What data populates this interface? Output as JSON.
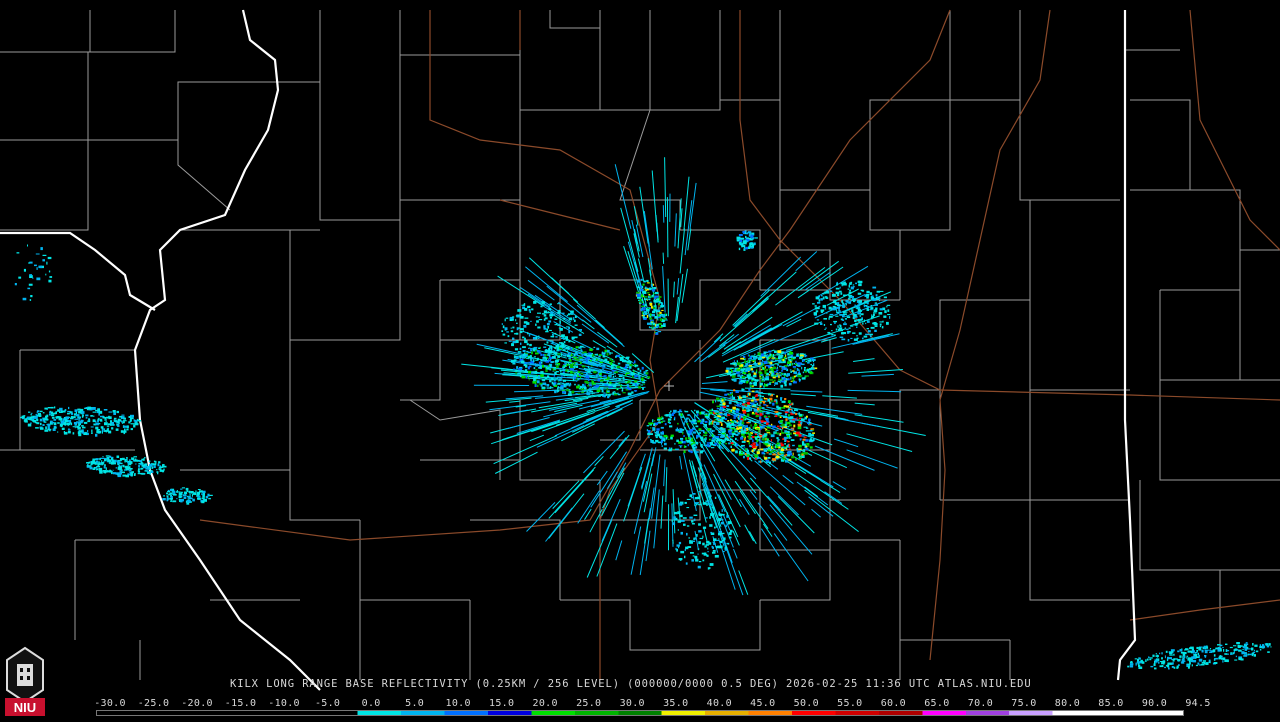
{
  "caption": "KILX LONG RANGE BASE REFLECTIVITY (0.25KM / 256 LEVEL) (000000/0000 0.5 DEG) 2026-02-25 11:36 UTC  ATLAS.NIU.EDU",
  "logo": {
    "text": "NIU",
    "color": "#c8102e"
  },
  "map_colors": {
    "background": "#000000",
    "county_lines": "#9a9a9a",
    "state_lines": "#ffffff",
    "highways": "#8b4a2a"
  },
  "scale": {
    "ticks": [
      "-30.0",
      "-25.0",
      "-20.0",
      "-15.0",
      "-10.0",
      "-5.0",
      "0.0",
      "5.0",
      "10.0",
      "15.0",
      "20.0",
      "25.0",
      "30.0",
      "35.0",
      "40.0",
      "45.0",
      "50.0",
      "55.0",
      "60.0",
      "65.0",
      "70.0",
      "75.0",
      "80.0",
      "85.0",
      "90.0",
      "94.5"
    ],
    "colors": [
      "#000000",
      "#000000",
      "#000000",
      "#000000",
      "#000000",
      "#000000",
      "#00e5e5",
      "#00b4f0",
      "#0070ff",
      "#0000e0",
      "#00e000",
      "#00b400",
      "#008000",
      "#f0f000",
      "#e7b000",
      "#ff8000",
      "#ff0000",
      "#d00000",
      "#b00000",
      "#ff00ff",
      "#a040e0",
      "#c8a0ff",
      "#ffffff",
      "#ffffff",
      "#ffffff"
    ]
  }
}
